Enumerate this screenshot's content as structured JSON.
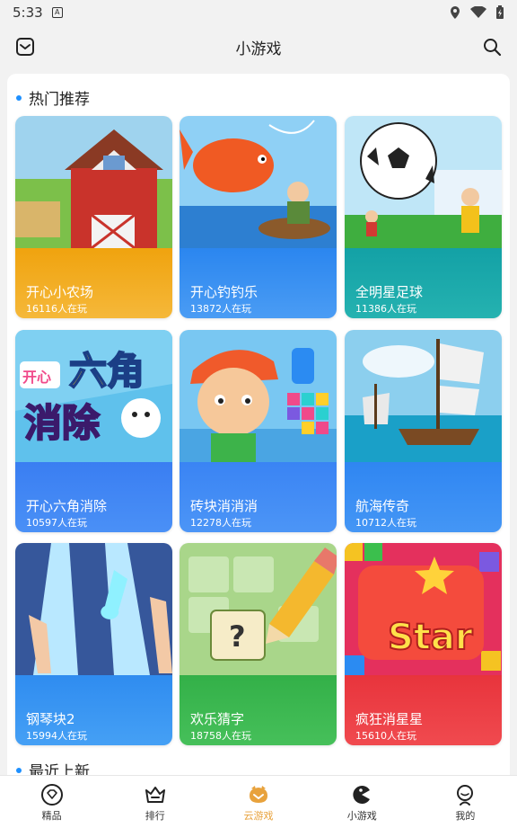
{
  "status": {
    "time": "5:33",
    "sim_badge": "A"
  },
  "header": {
    "title": "小游戏"
  },
  "sections": [
    {
      "title": "热门推荐"
    },
    {
      "title": "最近上新"
    }
  ],
  "games": [
    {
      "name": "开心小农场",
      "players": "16116人在玩",
      "art_text": ""
    },
    {
      "name": "开心钓钓乐",
      "players": "13872人在玩",
      "art_text": ""
    },
    {
      "name": "全明星足球",
      "players": "11386人在玩",
      "art_text": ""
    },
    {
      "name": "开心六角消除",
      "players": "10597人在玩",
      "art_text": "开心六角消除"
    },
    {
      "name": "砖块消消消",
      "players": "12278人在玩",
      "art_text": ""
    },
    {
      "name": "航海传奇",
      "players": "10712人在玩",
      "art_text": ""
    },
    {
      "name": "钢琴块2",
      "players": "15994人在玩",
      "art_text": ""
    },
    {
      "name": "欢乐猜字",
      "players": "18758人在玩",
      "art_text": "负?言"
    },
    {
      "name": "疯狂消星星",
      "players": "15610人在玩",
      "art_text": "Star"
    }
  ],
  "nav": [
    {
      "label": "精品",
      "icon": "diamond-icon"
    },
    {
      "label": "排行",
      "icon": "crown-icon"
    },
    {
      "label": "云游戏",
      "icon": "cloud-game-icon",
      "active": true
    },
    {
      "label": "小游戏",
      "icon": "pacman-icon"
    },
    {
      "label": "我的",
      "icon": "profile-icon"
    }
  ],
  "colors": {
    "accent": "#1e90ff",
    "active_tab": "#e8a23c",
    "card_info": [
      "#f2a811",
      "#2d8cf0",
      "#15a3a8",
      "#3b7ff3",
      "#3a84f4",
      "#2f86f2",
      "#2f8cf0",
      "#36b34a",
      "#e8363e"
    ]
  }
}
